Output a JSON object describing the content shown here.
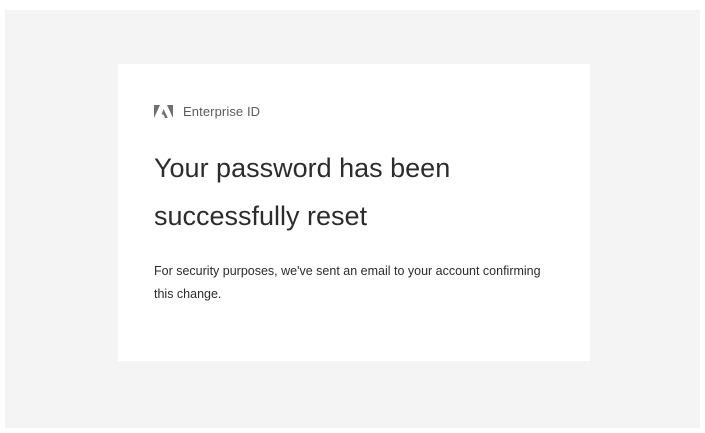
{
  "brand": {
    "logo_icon": "adobe-logo-icon",
    "name": "Enterprise ID"
  },
  "main": {
    "heading": "Your password has been successfully reset",
    "message": "For security purposes, we've sent an email to your account confirming this change."
  },
  "colors": {
    "background": "#f4f4f4",
    "card": "#ffffff",
    "text": "#2c2c2c",
    "muted_text": "#5c5c5c"
  }
}
